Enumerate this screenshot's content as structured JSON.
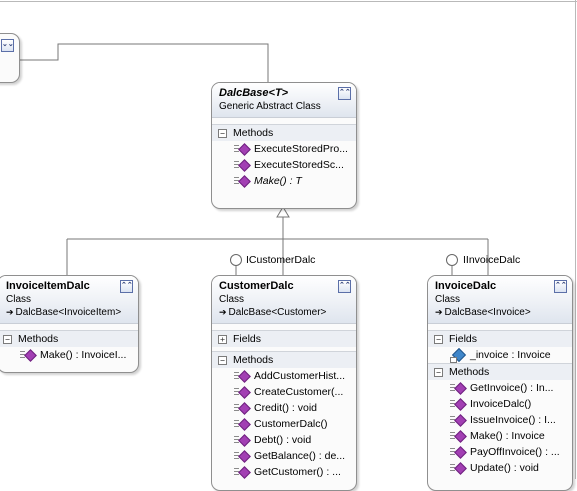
{
  "classes": {
    "dalcbase": {
      "title": "DalcBase<T>",
      "subtitle": "Generic Abstract Class",
      "methods_label": "Methods",
      "methods": [
        "ExecuteStoredPro...",
        "ExecuteStoredSc...",
        "Make() : T"
      ]
    },
    "invoiceitemdalc": {
      "title": "InvoiceItemDalc",
      "subtitle": "Class",
      "inherits": "DalcBase<InvoiceItem>",
      "methods_label": "Methods",
      "methods": [
        "Make() : InvoiceI..."
      ]
    },
    "customerdalc": {
      "title": "CustomerDalc",
      "subtitle": "Class",
      "inherits": "DalcBase<Customer>",
      "fields_label": "Fields",
      "methods_label": "Methods",
      "methods": [
        "AddCustomerHist...",
        "CreateCustomer(...",
        "Credit() : void",
        "CustomerDalc()",
        "Debt() : void",
        "GetBalance() : de...",
        "GetCustomer() : ..."
      ]
    },
    "invoicedalc": {
      "title": "InvoiceDalc",
      "subtitle": "Class",
      "inherits": "DalcBase<Invoice>",
      "fields_label": "Fields",
      "fields": [
        "_invoice : Invoice"
      ],
      "methods_label": "Methods",
      "methods": [
        "GetInvoice() : In...",
        "InvoiceDalc()",
        "IssueInvoice() : I...",
        "Make() : Invoice",
        "PayOffInvoice() : ...",
        "Update() : void"
      ]
    }
  },
  "interfaces": {
    "icustomerdalc": "ICustomerDalc",
    "iinvoicedalc": "IInvoiceDalc"
  },
  "icons": {
    "collapse": "double-chevron-up-icon",
    "expand": "double-chevron-down-icon",
    "method": "method-icon",
    "field": "field-icon",
    "inherits": "inheritance-arrow-icon"
  }
}
